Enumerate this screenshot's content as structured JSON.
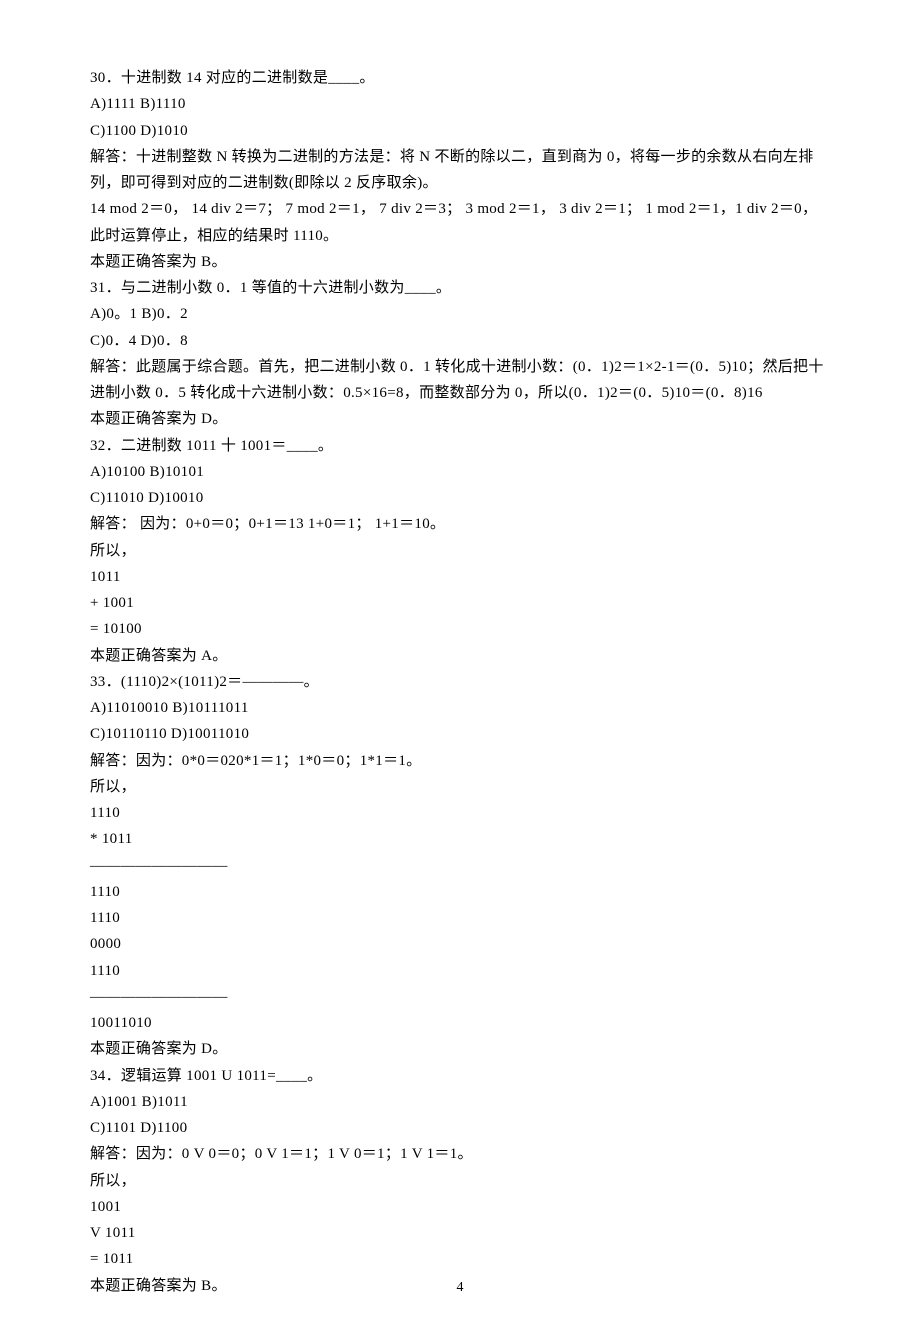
{
  "page_number": "4",
  "lines": [
    "30．十进制数 14 对应的二进制数是____。",
    "A)1111 B)1110",
    "C)1100 D)1010",
    "解答：十进制整数 N 转换为二进制的方法是：将 N 不断的除以二，直到商为 0，将每一步的余数从右向左排列，即可得到对应的二进制数(即除以 2 反序取余)。",
    "14 mod 2＝0， 14 div 2＝7； 7 mod 2＝1， 7 div 2＝3； 3 mod 2＝1， 3 div 2＝1； 1 mod 2＝1，1 div 2＝0，此时运算停止，相应的结果时 1110。",
    "本题正确答案为 B。",
    "31．与二进制小数 0．1 等值的十六进制小数为____。",
    "A)0。1 B)0．2",
    "C)0．4 D)0．8",
    "解答：此题属于综合题。首先，把二进制小数 0．1 转化成十进制小数：(0．1)2＝1×2-1＝(0．5)10；然后把十进制小数 0．5 转化成十六进制小数：0.5×16=8，而整数部分为 0，所以(0．1)2＝(0．5)10＝(0．8)16",
    "本题正确答案为 D。",
    "32．二进制数 1011 十 1001＝____。",
    "A)10100 B)10101",
    "C)11010 D)10010",
    "解答： 因为：0+0＝0；0+1＝13 1+0＝1； 1+1＝10。",
    "所以，",
    "1011",
    "+ 1001",
    "= 10100",
    "本题正确答案为 A。",
    "33．(1110)2×(1011)2＝————。",
    "A)11010010 B)10111011",
    "C)10110110 D)10011010",
    "解答：因为：0*0＝020*1＝1；1*0＝0；1*1＝1。",
    "所以，",
    "1110",
    "* 1011",
    "—————————",
    "1110",
    "1110",
    "0000",
    "1110",
    "—————————",
    "10011010",
    "本题正确答案为 D。",
    "34．逻辑运算 1001 U 1011=____。",
    "A)1001 B)1011",
    "C)1101 D)1100",
    "解答：因为：0 V 0＝0；0 V 1＝1；1 V 0＝1；1 V 1＝1。",
    "所以，",
    "1001",
    "V 1011",
    "= 1011",
    "本题正确答案为 B。"
  ]
}
